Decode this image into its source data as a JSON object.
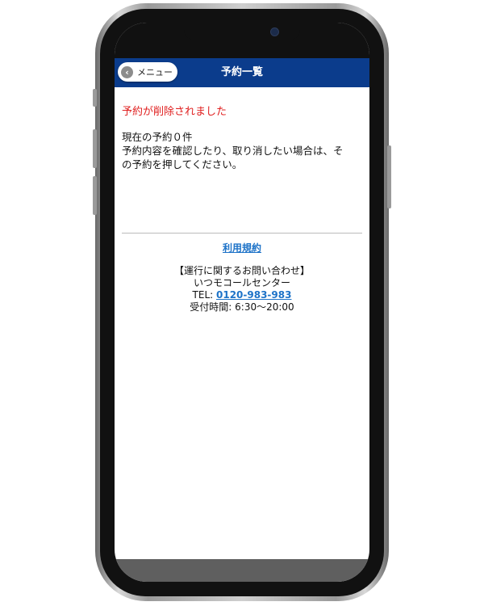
{
  "header": {
    "menu_label": "メニュー",
    "title": "予約一覧"
  },
  "icons": {
    "back": "chevron-left-icon"
  },
  "colors": {
    "header_bg": "#0b3c8c",
    "alert_text": "#e02020",
    "link": "#1e73c8"
  },
  "main": {
    "deleted_message": "予約が削除されました",
    "reservation_count": "現在の予約０件",
    "instructions_line1": "予約内容を確認したり、取り消したい場合は、そ",
    "instructions_line2": "の予約を押してください。"
  },
  "footer": {
    "terms_link": "利用規約",
    "contact_heading": "【運行に関するお問い合わせ】",
    "contact_name": "いつモコールセンター",
    "tel_prefix": "TEL: ",
    "tel_number": "0120-983-983",
    "hours": "受付時間: 6:30〜20:00"
  }
}
